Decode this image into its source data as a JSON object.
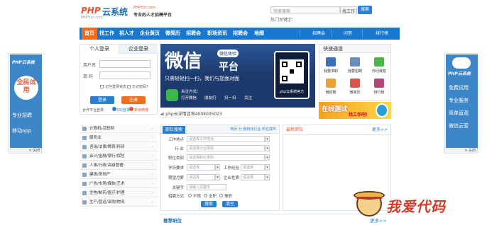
{
  "header": {
    "logo_php": "PHP",
    "logo_cloud": "云系统",
    "logo_url": "PHPYun.com",
    "slogan_en": "PHPYun.com",
    "slogan_cn": "专业的人才招聘平台",
    "search_placeholder": "快速搜索",
    "search_category": "找工作",
    "search_button": "搜索",
    "hot_words": "热门关键字："
  },
  "nav": {
    "items": [
      "首页",
      "找工作",
      "招人才",
      "企业黄页",
      "微简历",
      "招聘会",
      "职场资讯",
      "招聘会",
      "地图"
    ],
    "sub_items": [
      "招聘会",
      "问答",
      "排行榜"
    ]
  },
  "login": {
    "tab_personal": "个人登录",
    "tab_company": "企业登录",
    "username_label": "用户名",
    "password_label": "密  码",
    "remember_label": "记住登录状态",
    "forgot_label": "忘记密码?",
    "login_button": "登录",
    "register_button": "注册",
    "third_party_label": "合作平台登录:",
    "qq_label": "QQ登录",
    "weibo_label": "新浪微博"
  },
  "banner": {
    "title": "微信",
    "subtitle": "平台",
    "badge": "微信体验",
    "tagline": "只需轻轻扫一扫，我们与您面对面",
    "focus_label": "关注方式：",
    "steps": [
      "打开微信",
      "朋友们",
      "扫一扫",
      "关注"
    ],
    "site": "php云系统官方"
  },
  "notice": {
    "text": "php云详情咨询4008005023"
  },
  "express": {
    "title": "快速通道",
    "items": [
      "我要求职",
      "我要招聘",
      "你问我答",
      "微招聘",
      "微简历",
      "排行榜"
    ]
  },
  "promo": {
    "text": "在线测试",
    "subtext": "找工作吧！"
  },
  "left_ad": {
    "brand": "PHP云系统",
    "big": "全民试用",
    "line1": "专业招聘",
    "line2": "移动app",
    "close": "关闭"
  },
  "right_ad": {
    "brand": "PHP云系统",
    "lines": [
      "免费试用",
      "专业服务",
      "简单直观",
      "微信云营"
    ],
    "close": "关闭"
  },
  "categories": [
    "计算机/互联网",
    "服务业",
    "咨询/法律/教育/科研",
    "会计/金融/银行/保险",
    "人事/行政/高级管理",
    "建筑/房地产",
    "广告/市场/媒体/艺术",
    "生物/制药/医疗/护理",
    "生产/营运/采购/物流"
  ],
  "search_form": {
    "tab": "职位搜索",
    "extra": "简历 分 我将找行业 所在城市",
    "fields": {
      "work_location": {
        "label": "工作地点",
        "placeholder": "请选择工作地点"
      },
      "industry": {
        "label": "行  业",
        "placeholder": "请选择行业类别"
      },
      "position": {
        "label": "职位类别",
        "placeholder": "请选择职位类别"
      },
      "education": {
        "label": "学历要求",
        "placeholder": "请选择"
      },
      "experience": {
        "label": "工作经验",
        "placeholder": "请选择"
      },
      "salary": {
        "label": "期望月薪",
        "placeholder": "请选择"
      },
      "company_type": {
        "label": "企业性质",
        "placeholder": "请选择"
      },
      "keyword": {
        "label": "关键字",
        "placeholder": "请输入关键字"
      }
    },
    "recruit_label": "招聘方式",
    "radios": [
      "不限",
      "全职",
      "兼职"
    ],
    "search_button": "搜索",
    "reset_button": "清空"
  },
  "latest": {
    "title": "最新职位",
    "more": "更多>>"
  },
  "recommend": {
    "title": "推荐职位",
    "more": "更多>>"
  },
  "watermark": {
    "text": "我爱代码"
  },
  "colors": {
    "nav_blue": "#1878cf",
    "accent_orange": "#f16a1c",
    "brand_red": "#e8542f"
  }
}
